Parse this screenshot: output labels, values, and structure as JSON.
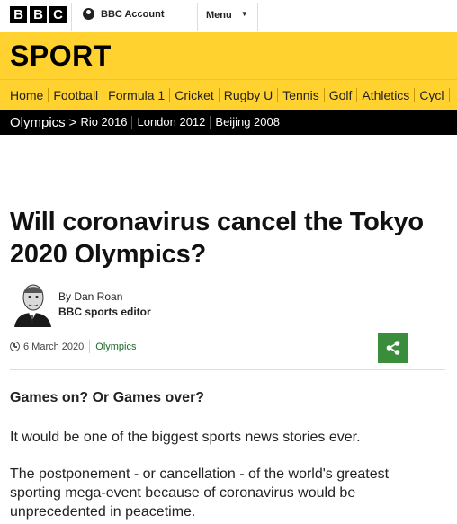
{
  "header": {
    "logo_letters": [
      "B",
      "B",
      "C"
    ],
    "account_label": "BBC Account",
    "menu_label": "Menu"
  },
  "section": {
    "title": "SPORT"
  },
  "nav": {
    "items": [
      "Home",
      "Football",
      "Formula 1",
      "Cricket",
      "Rugby U",
      "Tennis",
      "Golf",
      "Athletics",
      "Cycl"
    ]
  },
  "subnav": {
    "current": "Olympics",
    "arrow": ">",
    "items": [
      "Rio 2016",
      "London 2012",
      "Beijing 2008"
    ]
  },
  "article": {
    "headline": "Will coronavirus cancel the Tokyo 2020 Olympics?",
    "byline_name": "By Dan Roan",
    "byline_role": "BBC sports editor",
    "date": "6 March 2020",
    "tag": "Olympics",
    "lead": "Games on? Or Games over?",
    "paragraph_1": "It would be one of the biggest sports news stories ever.",
    "paragraph_2": "The postponement - or cancellation - of the world's greatest sporting mega-event because of coronavirus would be unprecedented in peacetime."
  },
  "colors": {
    "sport_yellow": "#ffd230",
    "subnav_black": "#000000",
    "share_green": "#3a8d3b",
    "tag_green": "#1a6a28"
  },
  "icons": [
    "account-icon",
    "chevron-down-icon",
    "clock-icon",
    "share-icon",
    "author-avatar"
  ]
}
